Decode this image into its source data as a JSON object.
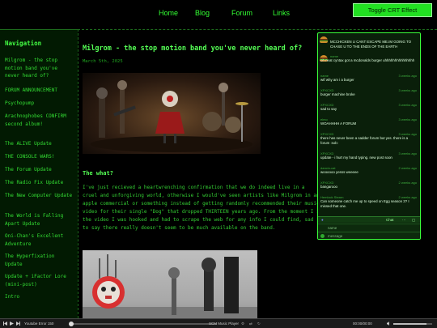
{
  "nav": {
    "links": [
      "Home",
      "Blog",
      "Forum",
      "Links"
    ],
    "crt_button": "Toggle CRT Effect"
  },
  "sidebar": {
    "title": "Navigation",
    "items": [
      "Milgrom - the stop motion band you've never heard of?",
      "FORUM ANNOUNCEMENT",
      "Psychopump",
      "Arachnophobes CONFIRM second album!",
      "The ALIVE Update",
      "THE CONSOLE WARS!",
      "The Forum Update",
      "The Radio Fix Update",
      "The New Computer Update",
      "The World is Falling Apart Update",
      "Oni-Chan's Excellent Adventure",
      "The Hyperfixation Update",
      "Update + iFactor Lore (mini-post)",
      "Intro"
    ]
  },
  "post": {
    "title": "Milgrom - the stop motion band you've never heard of?",
    "date": "March 5th, 2025",
    "section": "The what?",
    "lines": [
      "  I've just recieved a heartwrenching confirmation that we do indeed live in a",
      "cruel and unforgiving world, otherwise I would've seen artists like Milgrom in an",
      "apple commercial or something instead of getting randomly recommended their music",
      "video for their single \"Dog\" that dropped THIRTEEN years ago. From the moment I saw",
      "the video I was hooked and had to scrape the web for any info I could find, sad",
      "to say there really doesn't seem to be much available on the band."
    ]
  },
  "chat": {
    "messages": [
      {
        "name": "",
        "time": "",
        "text": "MCCHICKEN U CANT ESCAPE ME.IM GOING TO CHASE U TO THE ENDS OF THE EARTH",
        "burger": true
      },
      {
        "name": "name",
        "time": "",
        "text": "oh neat cyntax got a mcdonalds burger uhhhhhhhhhhhhhhh",
        "burger": true
      },
      {
        "name": "name",
        "time": "3 weeks ago",
        "text": "wtf why am i a burger",
        "burger": false
      },
      {
        "name": "XPXCXD",
        "time": "3 weeks ago",
        "text": "burger machine broke",
        "burger": false
      },
      {
        "name": "XPXCXD",
        "time": "3 weeks ago",
        "text": "sad to say",
        "burger": false
      },
      {
        "name": "elmo",
        "time": "3 weeks ago",
        "text": "WOAHHHH A FORUM",
        "burger": false
      },
      {
        "name": "XPXCXD",
        "time": "3 weeks ago",
        "text": "there has never been a sadder forum but yes. there is a forum :sob:",
        "burger": false
      },
      {
        "name": "XPXCXD",
        "time": "3 weeks ago",
        "text": "update - i hurt my hand typing. new post soon",
        "burger": false
      },
      {
        "name": "dancin-cat",
        "time": "2 weeks ago",
        "text": "woooooo yesss weeeee",
        "burger": false
      },
      {
        "name": "XPXCXD",
        "time": "2 weeks ago",
        "text": "bangarooo",
        "burger": false
      },
      {
        "name": "Hemlock Stearn",
        "time": "2 weeks ago",
        "text": "Can someone catch me up to speed on Egg season 3? I missed that one.",
        "burger": false
      }
    ],
    "tab_chat": "Chat",
    "name_placeholder": "name",
    "message_placeholder": "message"
  },
  "player": {
    "left_title": "Youtube Error 150",
    "left_progress": 0.0,
    "center_title": "SCM Music Player",
    "time": "00:00/00:00",
    "volume": 0.85
  }
}
